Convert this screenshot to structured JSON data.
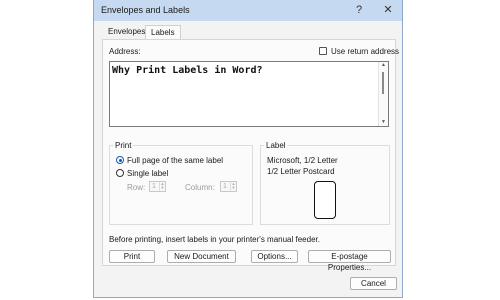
{
  "window": {
    "title": "Envelopes and Labels",
    "help_glyph": "?",
    "close_glyph": "✕"
  },
  "tabs": [
    {
      "label": "Envelopes"
    },
    {
      "label": "Labels"
    }
  ],
  "address": {
    "label": "Address:",
    "value": "Why Print Labels in Word?",
    "use_return_address_label": "Use return address",
    "use_return_address_checked": false
  },
  "print": {
    "group_title": "Print",
    "full_page_label": "Full page of the same label",
    "single_label_label": "Single label",
    "selected": "full_page",
    "row_label": "Row:",
    "row_value": "1",
    "column_label": "Column:",
    "column_value": "1"
  },
  "label_info": {
    "group_title": "Label",
    "line1": "Microsoft, 1/2 Letter",
    "line2": "1/2 Letter Postcard"
  },
  "instruction": "Before printing, insert labels in your printer's manual feeder.",
  "buttons": {
    "print": "Print",
    "new_document": "New Document",
    "options": "Options...",
    "epostage": "E-postage Properties...",
    "cancel": "Cancel"
  }
}
